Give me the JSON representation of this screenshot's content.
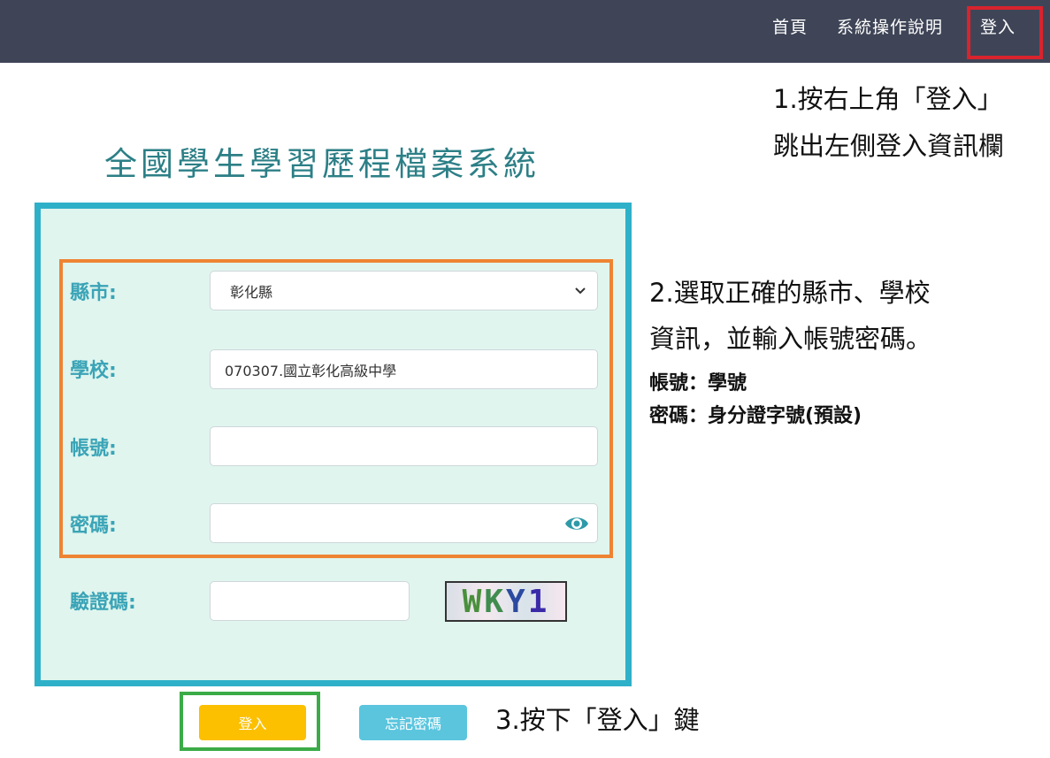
{
  "nav": {
    "home": "首頁",
    "guide": "系統操作說明",
    "login": "登入"
  },
  "title": "全國學生學習歷程檔案系統",
  "notes": {
    "step1_line1": "1.按右上角「登入」",
    "step1_line2": "跳出左側登入資訊欄",
    "step2_line1": "2.選取正確的縣市、學校",
    "step2_line2": "資訊，並輸入帳號密碼。",
    "account_hint": "帳號：學號",
    "password_hint": "密碼：身分證字號(預設)",
    "step3": "3.按下「登入」鍵"
  },
  "form": {
    "city_label": "縣市:",
    "city_value": "彰化縣",
    "school_label": "學校:",
    "school_value": "070307.國立彰化高級中學",
    "account_label": "帳號:",
    "account_value": "",
    "password_label": "密碼:",
    "password_value": "",
    "captcha_label": "驗證碼:",
    "captcha_value": "",
    "captcha_chars": [
      "W",
      "K",
      "Y",
      "1"
    ]
  },
  "buttons": {
    "login": "登入",
    "forgot_password": "忘記密碼"
  },
  "colors": {
    "topbar": "#3f4557",
    "title": "#2c7f86",
    "panel_bg": "#e0f5ee",
    "panel_border": "#2fb0c9",
    "label": "#3aa4b7",
    "login_button": "#fcc000",
    "forgot_button": "#5bc5de",
    "highlight_red": "#d9232d",
    "highlight_orange": "#ee8433",
    "highlight_green": "#3bab47"
  }
}
